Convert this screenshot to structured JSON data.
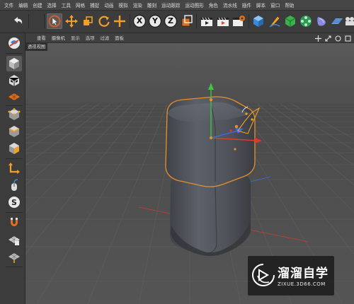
{
  "menu": [
    "文件",
    "编辑",
    "创建",
    "选择",
    "工具",
    "网格",
    "捕捉",
    "动画",
    "模拟",
    "渲染",
    "雕刻",
    "运动跟踪",
    "运动图形",
    "角色",
    "流水线",
    "插件",
    "脚本",
    "窗口",
    "帮助"
  ],
  "toolbar": {
    "undo": "undo-icon",
    "tools": [
      "live-selection-icon",
      "move-icon",
      "scale-icon",
      "rotate-icon",
      "recent-tool-icon"
    ],
    "axis": [
      "X",
      "Y",
      "Z"
    ],
    "coord": "world-coordinates-icon",
    "render": [
      "render-view-icon",
      "render-to-picture-viewer-icon",
      "render-settings-icon"
    ],
    "objects": [
      "cube-icon",
      "pen-icon",
      "subdivision-icon",
      "cloner-icon",
      "deformer-icon",
      "floor-icon",
      "camera-icon"
    ]
  },
  "sidebar": [
    "make-editable-icon",
    "model-mode-icon",
    "texture-mode-icon",
    "workplane-icon",
    "points-mode-icon",
    "edges-mode-icon",
    "polygons-mode-icon",
    "axis-mode-icon",
    "tweak-mode-icon",
    "snap-icon",
    "magnet-icon",
    "lock-workplane-icon",
    "planar-workplane-icon"
  ],
  "viewport": {
    "menu": [
      "查看",
      "摄像机",
      "显示",
      "选项",
      "过滤",
      "面板"
    ],
    "label": "透视视图",
    "nav_icons": [
      "pan-icon",
      "zoom-icon",
      "orbit-icon",
      "maximize-icon"
    ]
  },
  "watermark": {
    "title": "溜溜自学",
    "url": "ZIXUE.3D66.COM"
  },
  "colors": {
    "selection_orange": "#e8902a",
    "axis_x": "#e03a2a",
    "axis_y": "#3fc43f",
    "axis_z": "#3a6ce8"
  }
}
